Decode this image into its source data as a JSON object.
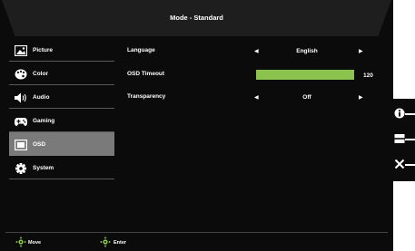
{
  "title": "Mode - Standard",
  "sidebar": {
    "items": [
      {
        "label": "Picture",
        "icon": "picture-icon",
        "active": false
      },
      {
        "label": "Color",
        "icon": "palette-icon",
        "active": false
      },
      {
        "label": "Audio",
        "icon": "speaker-icon",
        "active": false
      },
      {
        "label": "Gaming",
        "icon": "gamepad-icon",
        "active": false
      },
      {
        "label": "OSD",
        "icon": "osd-window-icon",
        "active": true
      },
      {
        "label": "System",
        "icon": "gear-icon",
        "active": false
      }
    ]
  },
  "settings": {
    "language": {
      "label": "Language",
      "value": "English"
    },
    "osd_timeout": {
      "label": "OSD Timeout",
      "value": "120",
      "fill_percent": 100,
      "bar_color": "#8cc34f"
    },
    "transparency": {
      "label": "Transparency",
      "value": "Off"
    }
  },
  "footer": {
    "move_label": "Move",
    "enter_label": "Enter"
  },
  "side_keys": [
    "info-icon",
    "input-source-icon",
    "close-icon"
  ],
  "colors": {
    "background": "#0b0b0b",
    "active_item": "#7a7a7a",
    "accent_green": "#8cc34f"
  }
}
